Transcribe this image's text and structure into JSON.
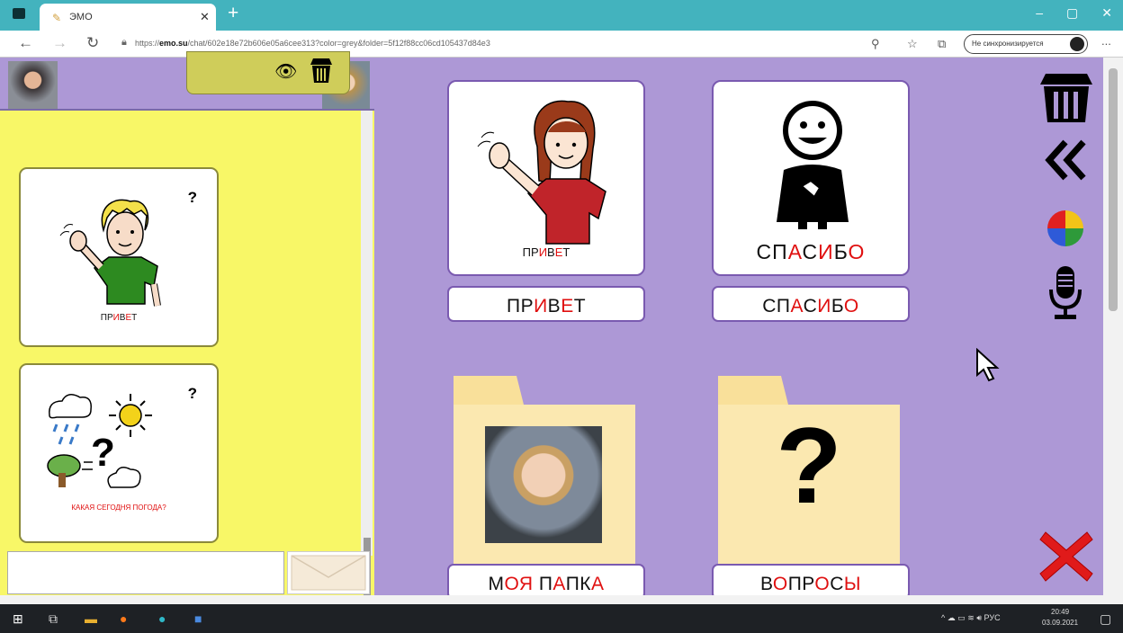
{
  "browser": {
    "tab_title": "ЭМО",
    "url_prefix": "https://",
    "url_host": "emo.su",
    "url_path": "/chat/602e18e72b606e05a6cee313?color=grey&folder=5f12f88cc06cd105437d84e3",
    "sync_label": "Не синхронизируется",
    "more": "..."
  },
  "left_panel": {
    "card1": {
      "question": "?",
      "label_parts": [
        "ПР",
        "И",
        "В",
        "Е",
        "Т"
      ]
    },
    "card2": {
      "question": "?",
      "label": "КАКАЯ СЕГОДНЯ ПОГОДА?"
    },
    "input_value": ""
  },
  "main": {
    "cards": [
      {
        "id": "privet",
        "picture_label_parts": [
          "ПР",
          "И",
          "В",
          "Е",
          "Т"
        ],
        "button_parts": [
          "ПР",
          "И",
          "В",
          "Е",
          "Т"
        ]
      },
      {
        "id": "spasibo",
        "picture_label_parts": [
          "СП",
          "А",
          "С",
          "И",
          "Б",
          "О"
        ],
        "button_parts": [
          "СП",
          "А",
          "С",
          "И",
          "Б",
          "О"
        ]
      }
    ],
    "folders": [
      {
        "id": "moya-papka",
        "button_parts": [
          "М",
          "О",
          "Я",
          " П",
          "А",
          "П",
          "К",
          "А"
        ]
      },
      {
        "id": "voprosy",
        "glyph": "?",
        "button_parts": [
          "В",
          "О",
          "ПР",
          "О",
          "С",
          "Ы"
        ]
      }
    ]
  },
  "taskbar": {
    "lang": "РУС",
    "time": "20:49",
    "date": "03.09.2021"
  },
  "colors": {
    "main_bg": "#ad98d6",
    "left_bg": "#f8f767",
    "accent_red": "#e01010",
    "titlebar": "#43b3be"
  }
}
